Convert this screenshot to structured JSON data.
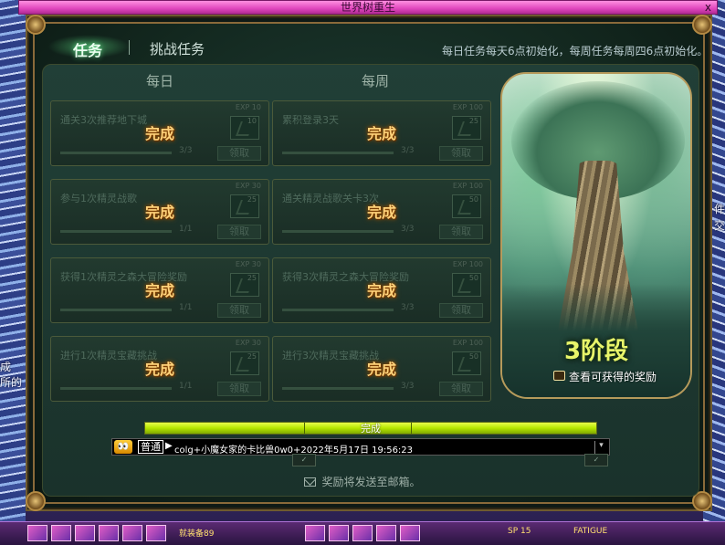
{
  "window": {
    "title": "世界树重生",
    "close_label": "x"
  },
  "tabs": [
    {
      "label": "任务",
      "active": true
    },
    {
      "label": "挑战任务",
      "active": false
    }
  ],
  "reset_note": "每日任务每天6点初始化，每周任务每周四6点初始化。",
  "columns": {
    "daily": "每日",
    "weekly": "每周"
  },
  "daily_quests": [
    {
      "name": "通关3次推荐地下城",
      "exp": "EXP 10",
      "icon_count": "10",
      "progress": "3/3",
      "claim": "领取",
      "status": "完成",
      "progress_value": 1.0
    },
    {
      "name": "参与1次精灵战歌",
      "exp": "EXP 30",
      "icon_count": "25",
      "progress": "1/1",
      "claim": "领取",
      "status": "完成",
      "progress_value": 1.0
    },
    {
      "name": "获得1次精灵之森大冒险奖励",
      "exp": "EXP 30",
      "icon_count": "25",
      "progress": "1/1",
      "claim": "领取",
      "status": "完成",
      "progress_value": 1.0
    },
    {
      "name": "进行1次精灵宝藏挑战",
      "exp": "EXP 30",
      "icon_count": "25",
      "progress": "1/1",
      "claim": "领取",
      "status": "完成",
      "progress_value": 1.0
    }
  ],
  "weekly_quests": [
    {
      "name": "累积登录3天",
      "exp": "EXP 100",
      "icon_count": "25",
      "progress": "3/3",
      "claim": "领取",
      "status": "完成",
      "progress_value": 1.0
    },
    {
      "name": "通关精灵战歌关卡3次",
      "exp": "EXP 100",
      "icon_count": "50",
      "progress": "3/3",
      "claim": "领取",
      "status": "完成",
      "progress_value": 1.0
    },
    {
      "name": "获得3次精灵之森大冒险奖励",
      "exp": "EXP 100",
      "icon_count": "50",
      "progress": "3/3",
      "claim": "领取",
      "status": "完成",
      "progress_value": 1.0
    },
    {
      "name": "进行3次精灵宝藏挑战",
      "exp": "EXP 100",
      "icon_count": "50",
      "progress": "3/3",
      "claim": "领取",
      "status": "完成",
      "progress_value": 1.0
    }
  ],
  "tree_panel": {
    "stage": "3阶段",
    "reward_link": "查看可获得的奖励",
    "icon": "gift-box-icon"
  },
  "overall_progress": {
    "label": "完成",
    "value": 1.0
  },
  "chat": {
    "icon_label": "👀",
    "channel": "普通",
    "arrow": "▶",
    "message": "colg+小魔女家的卡比兽0w0+2022年5月17日 19:56:23"
  },
  "mail_note": "奖励将发送至邮箱。",
  "side_text": {
    "left_lines": [
      "成",
      "所的"
    ],
    "right_lines": [
      "件",
      "交"
    ]
  },
  "hud": {
    "level_text": "就装备89",
    "sp_text": "SP 15",
    "fatigue_text": "FATIGUE"
  },
  "colors": {
    "accent_done": "#ffd27a",
    "stage_text": "#e8f56a",
    "progress_bar": "#b6e600",
    "title_bar": "#e046bd"
  }
}
